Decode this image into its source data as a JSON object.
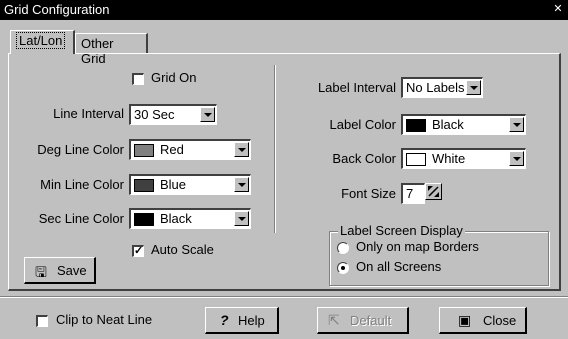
{
  "window": {
    "title": "Grid Configuration",
    "close_glyph": "✕"
  },
  "tabs": [
    {
      "label": "Lat/Lon",
      "active": true
    },
    {
      "label": "Other Grid",
      "active": false
    }
  ],
  "left": {
    "grid_on": {
      "label": "Grid On",
      "checked": false
    },
    "line_interval": {
      "label": "Line Interval",
      "value": "30 Sec"
    },
    "deg_line_color": {
      "label": "Deg Line Color",
      "value": "Red",
      "swatch": "#808080"
    },
    "min_line_color": {
      "label": "Min Line Color",
      "value": "Blue",
      "swatch": "#404040"
    },
    "sec_line_color": {
      "label": "Sec Line Color",
      "value": "Black",
      "swatch": "#000000"
    },
    "auto_scale": {
      "label": "Auto Scale",
      "checked": true
    },
    "save_button": {
      "label": "Save",
      "icon": "save-icon"
    }
  },
  "right": {
    "label_interval": {
      "label": "Label Interval",
      "value": "No Labels"
    },
    "label_color": {
      "label": "Label Color",
      "value": "Black",
      "swatch": "#000000"
    },
    "back_color": {
      "label": "Back Color",
      "value": "White",
      "swatch": "#ffffff"
    },
    "font_size": {
      "label": "Font Size",
      "value": "7"
    },
    "label_screen_display": {
      "legend": "Label Screen Display",
      "options": [
        {
          "label": "Only on map Borders",
          "selected": false
        },
        {
          "label": "On all Screens",
          "selected": true
        }
      ]
    }
  },
  "bottom": {
    "clip_to_neat_line": {
      "label": "Clip to Neat Line",
      "checked": false
    },
    "help_button": {
      "label": "Help",
      "icon": "question-icon"
    },
    "default_button": {
      "label": "Default",
      "icon": "default-icon",
      "disabled": true
    },
    "close_button": {
      "label": "Close",
      "icon": "close-door-icon"
    }
  }
}
